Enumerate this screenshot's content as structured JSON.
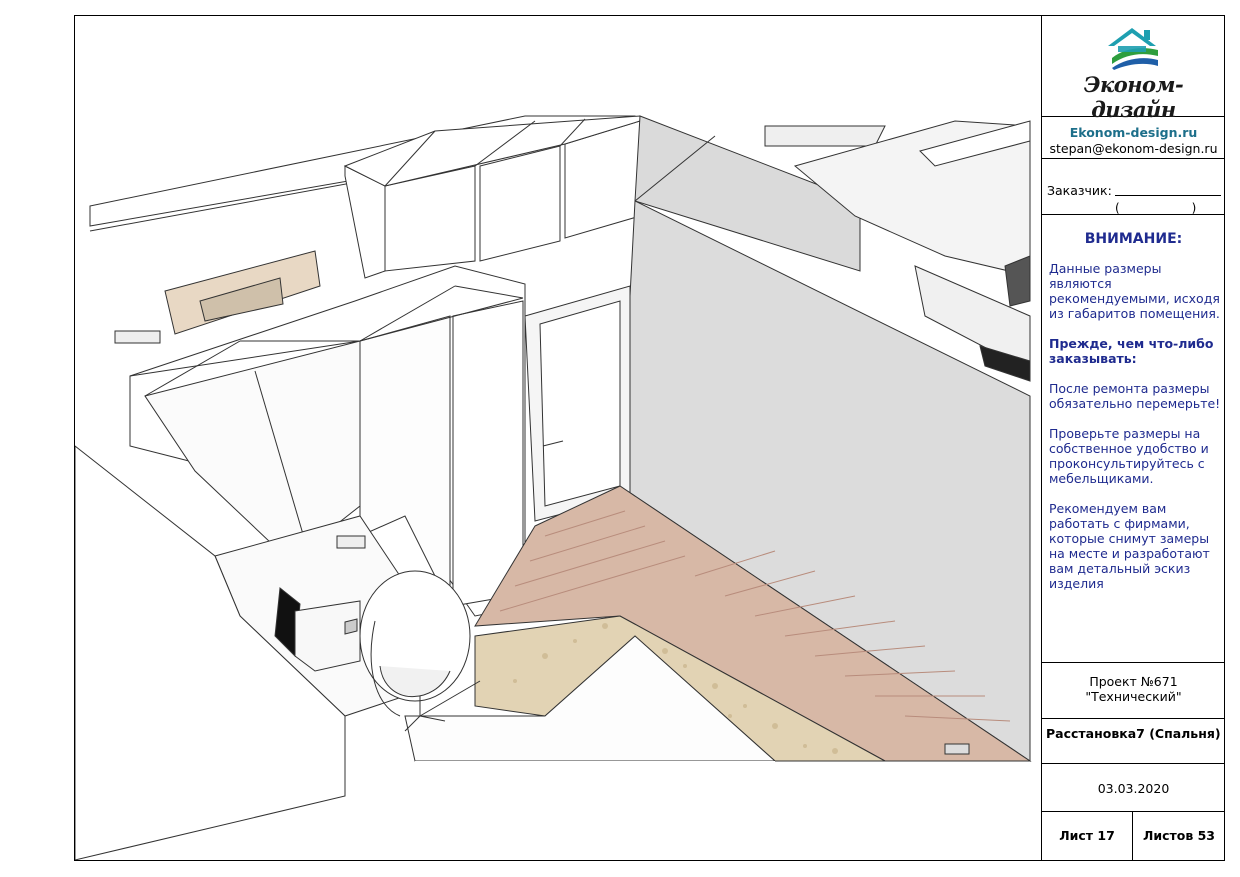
{
  "render": {
    "image": "3D interior render: bedroom layout viewed from above with wardrobes, door, desk with laptop, white chair, laminate floor and rug"
  },
  "title_block": {
    "logo": {
      "icon": "house-logo-icon",
      "text": "Эконом-дизайн",
      "colors": {
        "roof": "#1e9fb0",
        "green": "#2e9e3e",
        "blue": "#1f5fa8"
      }
    },
    "site": {
      "url": "Ekonom-design.ru",
      "email": "stepan@ekonom-design.ru"
    },
    "client": {
      "label": "Заказчик:",
      "paren": "(____________)"
    },
    "notice": {
      "title": "ВНИМАНИЕ:",
      "p1": "Данные размеры являются рекомендуемыми, исходя из габаритов помещения.",
      "p2": "Прежде, чем что-либо заказывать:",
      "p3": "После ремонта размеры обязательно перемерьте!",
      "p4": "Проверьте размеры на собственное удобство и проконсультируйтесь с мебельщиками.",
      "p5": "Рекомендуем вам работать с фирмами, которые снимут замеры на месте и разработают вам детальный эскиз изделия",
      "color": "#1f2b8f"
    },
    "project": {
      "number": "Проект №671",
      "name": "\"Технический\""
    },
    "layout_name": "Расстановка7 (Спальня)",
    "date": "03.03.2020",
    "sheet": "Лист  17",
    "sheets_total": "Листов 53"
  }
}
